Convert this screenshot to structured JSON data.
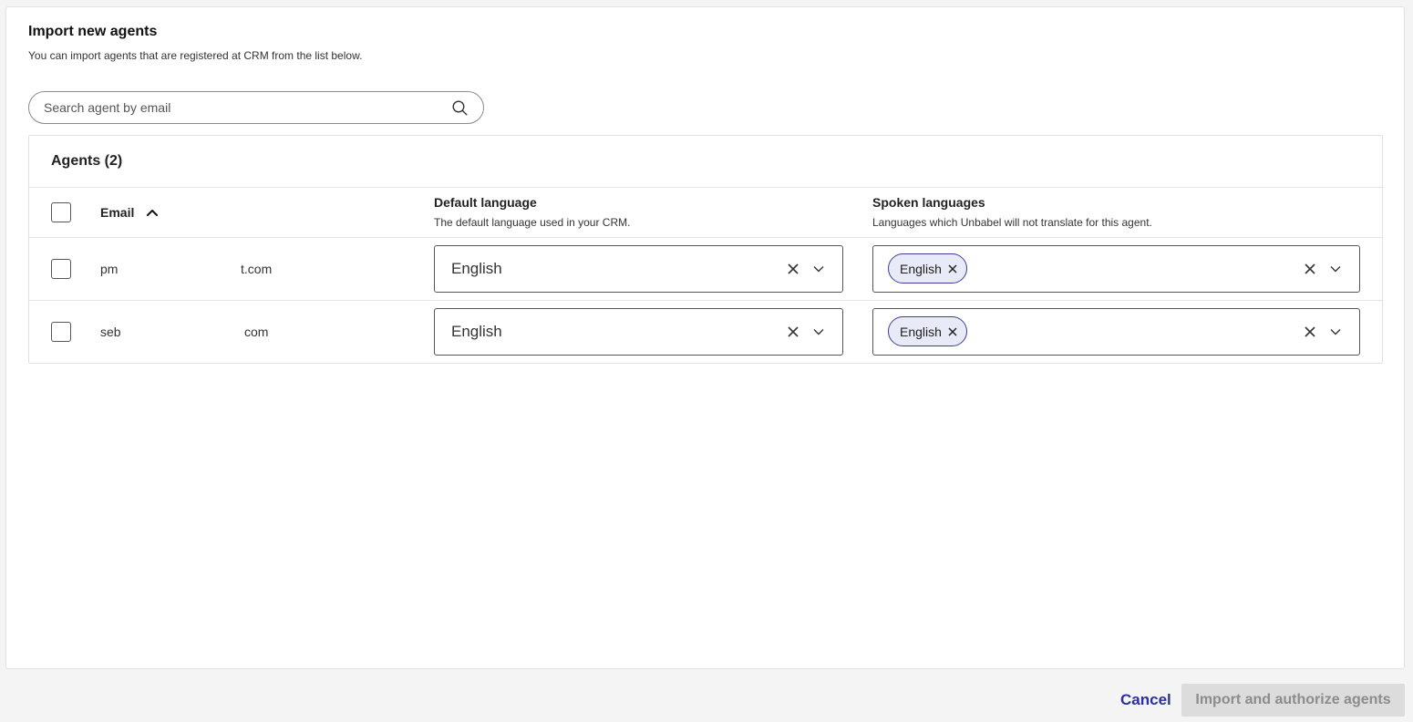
{
  "header": {
    "title": "Import new agents",
    "subtitle": "You can import agents that are registered at CRM from the list below."
  },
  "search": {
    "placeholder": "Search agent by email",
    "value": "",
    "icon": "search-icon"
  },
  "agents_table": {
    "title": "Agents (2)",
    "columns": {
      "email": {
        "label": "Email",
        "sort": "ascending"
      },
      "default_language": {
        "label": "Default language",
        "description": "The default language used in your CRM."
      },
      "spoken_languages": {
        "label": "Spoken languages",
        "description": "Languages which Unbabel will not translate for this agent."
      }
    },
    "rows": [
      {
        "email_prefix": "pm",
        "email_suffix": "t.com",
        "default_language": "English",
        "spoken_languages": [
          "English"
        ],
        "checked": false
      },
      {
        "email_prefix": "seb",
        "email_suffix": "com",
        "default_language": "English",
        "spoken_languages": [
          "English"
        ],
        "checked": false
      }
    ]
  },
  "footer": {
    "cancel_label": "Cancel",
    "import_label": "Import and authorize agents",
    "import_disabled": true
  },
  "colors": {
    "accent": "#2b2fa0",
    "chip_background": "#e9eaf7",
    "chip_border": "#3b3f9e",
    "disabled_button": "#dcdcdc"
  }
}
